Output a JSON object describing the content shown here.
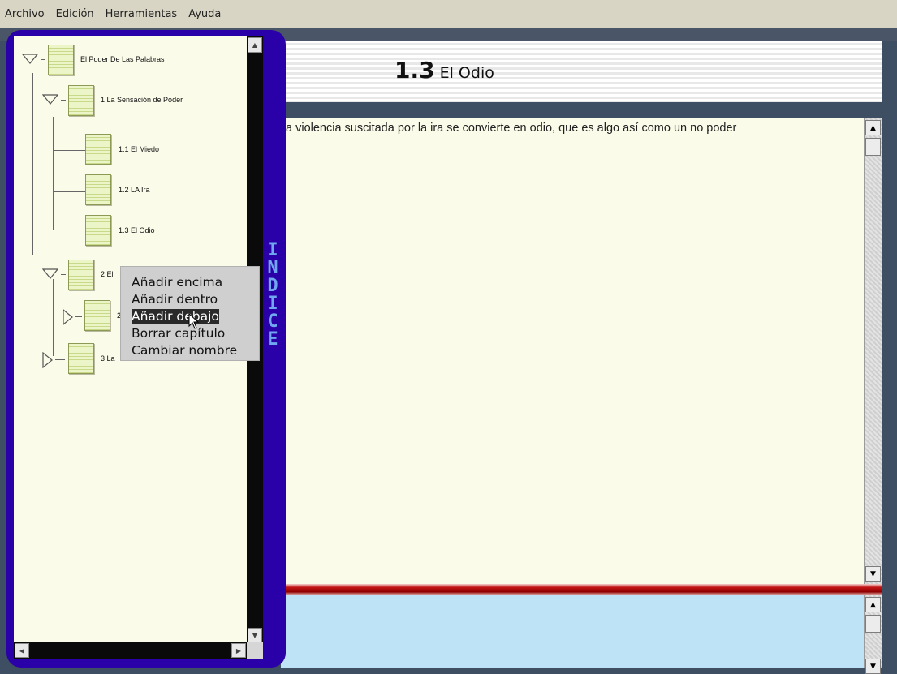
{
  "menu": {
    "items": [
      "Archivo",
      "Edición",
      "Herramientas",
      "Ayuda"
    ]
  },
  "section": {
    "number": "1.3",
    "title": "El Odio"
  },
  "content": {
    "text": "a violencia suscitada por la ira se convierte en odio, que es algo así como un no poder"
  },
  "sidebar": {
    "vertical_label": [
      "I",
      "N",
      "D",
      "I",
      "C",
      "E"
    ],
    "tree": {
      "root": "El Poder De Las Palabras",
      "ch1": "1 La Sensación de Poder",
      "ch1_1": "1.1 El Miedo",
      "ch1_2": "1.2 LA Ira",
      "ch1_3": "1.3 El Odio",
      "ch2": "2 El",
      "ch2_1": "2",
      "ch3": "3 La"
    }
  },
  "context_menu": {
    "items": [
      "Añadir encima",
      "Añadir dentro",
      "Añadir debajo",
      "Borrar capítulo",
      "Cambiar nombre"
    ],
    "highlighted": "Añadir debajo"
  },
  "colors": {
    "panel": "#2a00a8",
    "indice": "#6fa8ee",
    "accent_bar": "#c41414",
    "content_bg": "#fbfbea",
    "lower_bg": "#bee3f7"
  }
}
